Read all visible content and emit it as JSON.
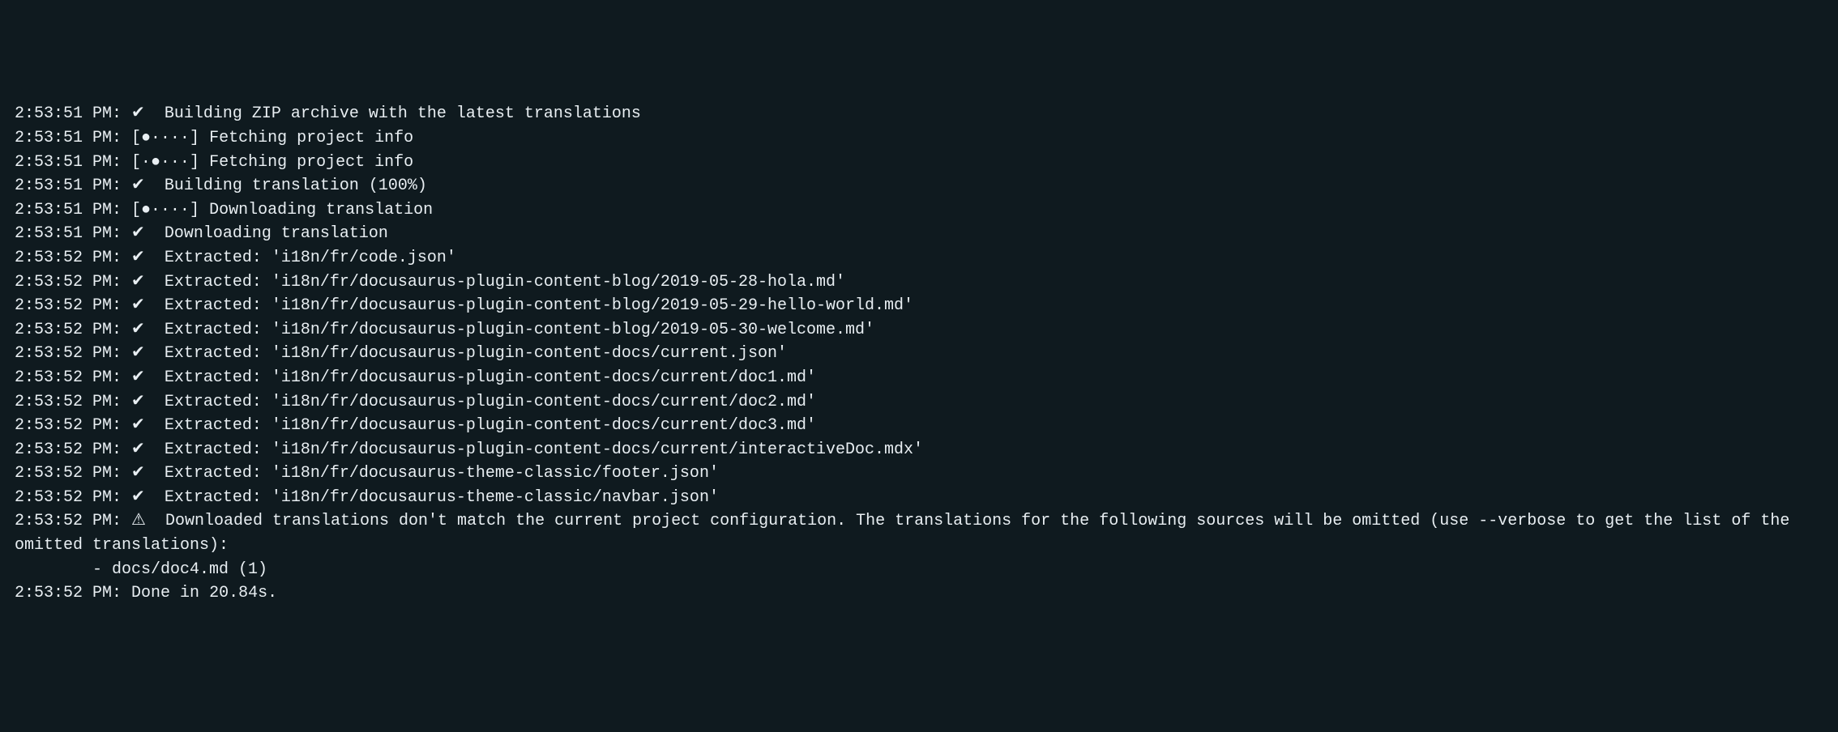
{
  "colors": {
    "background": "#0f1a1f",
    "foreground": "#e8eef2"
  },
  "log": {
    "lines": [
      {
        "time": "2:53:51 PM:",
        "icon": "✔",
        "msg": " Building ZIP archive with the latest translations"
      },
      {
        "time": "2:53:51 PM:",
        "icon": "[●∙∙∙∙]",
        "msg": "Fetching project info"
      },
      {
        "time": "2:53:51 PM:",
        "icon": "[∙●∙∙∙]",
        "msg": "Fetching project info"
      },
      {
        "time": "2:53:51 PM:",
        "icon": "✔",
        "msg": " Building translation (100%)"
      },
      {
        "time": "2:53:51 PM:",
        "icon": "[●∙∙∙∙]",
        "msg": "Downloading translation"
      },
      {
        "time": "2:53:51 PM:",
        "icon": "✔",
        "msg": " Downloading translation"
      },
      {
        "time": "2:53:52 PM:",
        "icon": "✔",
        "msg": " Extracted: 'i18n/fr/code.json'"
      },
      {
        "time": "2:53:52 PM:",
        "icon": "✔",
        "msg": " Extracted: 'i18n/fr/docusaurus-plugin-content-blog/2019-05-28-hola.md'"
      },
      {
        "time": "2:53:52 PM:",
        "icon": "✔",
        "msg": " Extracted: 'i18n/fr/docusaurus-plugin-content-blog/2019-05-29-hello-world.md'"
      },
      {
        "time": "2:53:52 PM:",
        "icon": "✔",
        "msg": " Extracted: 'i18n/fr/docusaurus-plugin-content-blog/2019-05-30-welcome.md'"
      },
      {
        "time": "2:53:52 PM:",
        "icon": "✔",
        "msg": " Extracted: 'i18n/fr/docusaurus-plugin-content-docs/current.json'"
      },
      {
        "time": "2:53:52 PM:",
        "icon": "✔",
        "msg": " Extracted: 'i18n/fr/docusaurus-plugin-content-docs/current/doc1.md'"
      },
      {
        "time": "2:53:52 PM:",
        "icon": "✔",
        "msg": " Extracted: 'i18n/fr/docusaurus-plugin-content-docs/current/doc2.md'"
      },
      {
        "time": "2:53:52 PM:",
        "icon": "✔",
        "msg": " Extracted: 'i18n/fr/docusaurus-plugin-content-docs/current/doc3.md'"
      },
      {
        "time": "2:53:52 PM:",
        "icon": "✔",
        "msg": " Extracted: 'i18n/fr/docusaurus-plugin-content-docs/current/interactiveDoc.mdx'"
      },
      {
        "time": "2:53:52 PM:",
        "icon": "✔",
        "msg": " Extracted: 'i18n/fr/docusaurus-theme-classic/footer.json'"
      },
      {
        "time": "2:53:52 PM:",
        "icon": "✔",
        "msg": " Extracted: 'i18n/fr/docusaurus-theme-classic/navbar.json'"
      },
      {
        "time": "2:53:52 PM:",
        "icon": "⚠",
        "msg": " Downloaded translations don't match the current project configuration. The translations for the following sources will be omitted (use --verbose to get the list of the omitted translations):"
      },
      {
        "time": "",
        "icon": "",
        "msg": "        - docs/doc4.md (1)"
      },
      {
        "time": "2:53:52 PM:",
        "icon": "",
        "msg": "Done in 20.84s."
      }
    ]
  }
}
